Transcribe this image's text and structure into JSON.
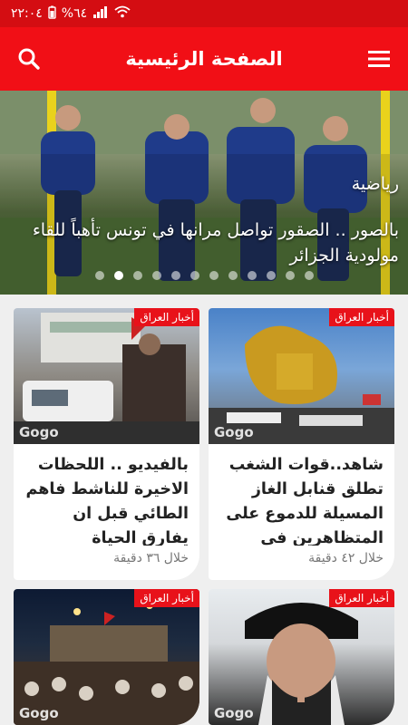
{
  "status": {
    "time": "٢٢:٠٤",
    "battery": "%٦٤",
    "colors": {
      "bar": "#d40d12"
    }
  },
  "appbar": {
    "title": "الصفحة الرئيسية",
    "menu_icon": "menu-icon",
    "search_icon": "search-icon",
    "color": "#f10f16"
  },
  "hero": {
    "category": "رياضية",
    "title": "بالصور .. الصقور تواصل مرانها في تونس تأهباً للقاء مولودية الجزائر",
    "slides": 12,
    "active_slide": 1
  },
  "cards": [
    {
      "badge": "أخبار العراق",
      "title": "شاهد..قوات الشغب تطلق قنابل الغاز المسيلة للدموع على المتظاهرين في كربلاء",
      "time": "خلال ٤٢ دقيقة",
      "watermark": "Gogo"
    },
    {
      "badge": "أخبار العراق",
      "title": "بالفيديو .. اللحظات الاخيرة للناشط فاهم الطائي قبل ان يفارق الحياة",
      "time": "خلال ٣٦ دقيقة",
      "watermark": "Gogo"
    },
    {
      "badge": "أخبار العراق",
      "title": "",
      "time": "",
      "watermark": "Gogo"
    },
    {
      "badge": "أخبار العراق",
      "title": "",
      "time": "",
      "watermark": "Gogo"
    }
  ]
}
